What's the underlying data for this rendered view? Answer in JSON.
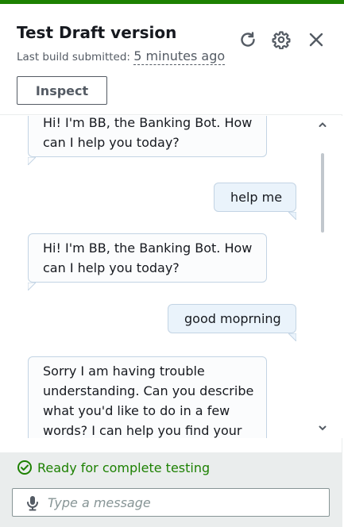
{
  "header": {
    "title": "Test Draft version",
    "subtitle_prefix": "Last build submitted: ",
    "subtitle_time": "5 minutes ago",
    "inspect_label": "Inspect",
    "icons": [
      "refresh-icon",
      "settings-gear-icon",
      "close-icon"
    ]
  },
  "chat": {
    "messages": [
      {
        "role": "bot",
        "text": "Hi! I'm BB, the Banking Bot. How can I help you today?"
      },
      {
        "role": "user",
        "text": "help me"
      },
      {
        "role": "bot",
        "text": "Hi! I'm BB, the Banking Bot. How can I help you today?"
      },
      {
        "role": "user",
        "text": "good moprning"
      },
      {
        "role": "bot",
        "text": "Sorry I am having trouble understanding. Can you describe what you'd like to do in a few words? I can help you find your"
      }
    ]
  },
  "footer": {
    "status_text": "Ready for complete testing",
    "input_placeholder": "Type a message"
  },
  "colors": {
    "accent_green": "#1d8102",
    "bot_bubble_bg": "#fbfcfd",
    "user_bubble_bg": "#eaf3fb",
    "bubble_border": "#c3d4e4"
  }
}
